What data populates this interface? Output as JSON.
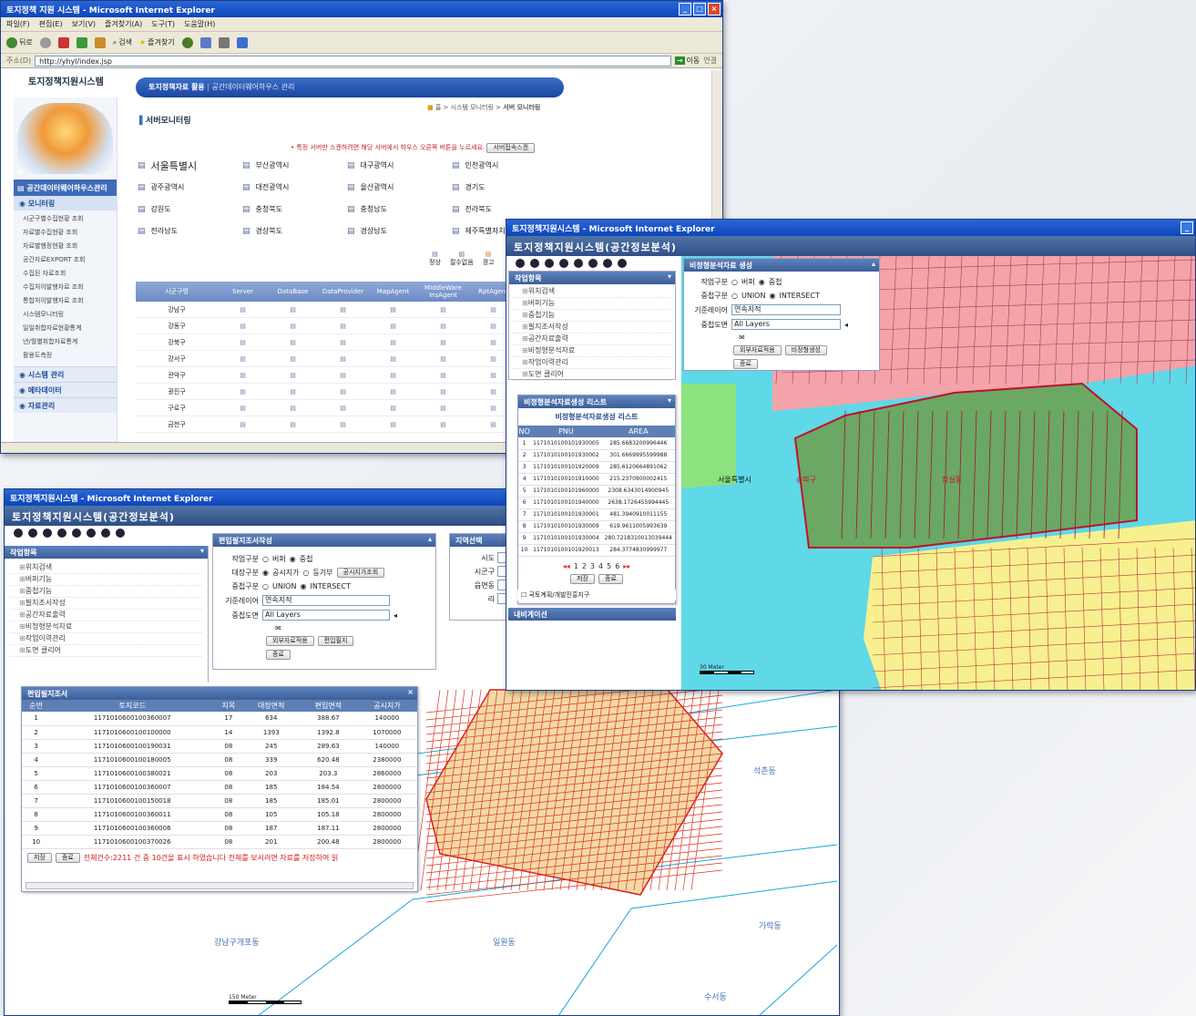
{
  "win1": {
    "title": "토지정책 지원 시스템 - Microsoft Internet Explorer",
    "menu": [
      "파일(F)",
      "편집(E)",
      "보기(V)",
      "즐겨찾기(A)",
      "도구(T)",
      "도움말(H)"
    ],
    "toolbar": {
      "back": "뒤로",
      "search": "검색",
      "favorites": "즐겨찾기"
    },
    "address": {
      "label": "주소(D)",
      "url": "http://yhyl/index.jsp",
      "go": "이동",
      "links": "연결"
    },
    "logo": "토지정책지원시스템",
    "topnav": {
      "item1": "토지정책자료 활용",
      "item2": "공간데이터웨어하우스 관리"
    },
    "breadcrumb": {
      "home": "홈",
      "level1": "시스템 모니터링",
      "current": "서버 모니터링"
    },
    "page_title": "서버모니터링",
    "notice": "• 특정 서버만 스캔하려면 해당 서버에서 하우스 오른쪽 버튼을 누르세요.",
    "notice_button": "서버접속스캔",
    "sidebar_header": "공간데이터웨어하우스관리",
    "sidebar_section": "모니터링",
    "sidebar_items": [
      "시군구별수집현황 조회",
      "자료별수집현황 조회",
      "자료별행정현황 조회",
      "공간자료EXPORT 조회",
      "수집된 자료조회",
      "수집처이발행자료 조회",
      "통합처이발행자료 조회",
      "시스템모니터링",
      "일일취합자료현황통계",
      "년/월별취합자료통계",
      "활용도측정"
    ],
    "sidebar_menus": [
      "시스템 관리",
      "메타데이터",
      "자료관리"
    ],
    "regions": [
      "서울특별시",
      "부산광역시",
      "대구광역시",
      "인천광역시",
      "광주광역시",
      "대전광역시",
      "울산광역시",
      "경기도",
      "강원도",
      "충청북도",
      "충청남도",
      "전라북도",
      "전라남도",
      "경상북도",
      "경상남도",
      "제주특별자치도"
    ],
    "legend": [
      "정상",
      "절수없음",
      "경고"
    ],
    "table_headers": [
      "시군구명",
      "Server",
      "DataBase",
      "DataProvider",
      "MapAgent",
      "MiddleWare InsAgent",
      "RptAgent"
    ],
    "table_rows": [
      "강남구",
      "강동구",
      "강북구",
      "강서구",
      "관악구",
      "광진구",
      "구로구",
      "금천구"
    ]
  },
  "win2": {
    "title": "토지정책지원시스템 - Microsoft Internet Explorer",
    "app_title": "토지정책지원시스템(공간정보분석)",
    "work_panel": "작업항목",
    "work_items": [
      "위치검색",
      "버퍼기능",
      "중첩기능",
      "필지조서작성",
      "공간자료출력",
      "비정형분석자료",
      "작업이력관리",
      "도면 클리어"
    ],
    "form_title": "비정형분석자료 생성",
    "form": {
      "work_type": "작업구분",
      "opt_buffer": "버퍼",
      "opt_overlay": "중첩",
      "overlay_type": "중첩구분",
      "opt_union": "UNION",
      "opt_intersect": "INTERSECT",
      "base_layer": "기준레이어",
      "base_value": "연속지적",
      "overlay_map": "중첩도면",
      "overlay_value": "All Layers",
      "btn_select": "외부자료적용",
      "btn_run": "비정형생성",
      "btn_close": "종료"
    },
    "result_tab": "비정형분석자료생성 리스트",
    "list_title": "비정형분석자료생성 리스트",
    "list_headers": [
      "NO",
      "PNU",
      "AREA"
    ],
    "list_rows": [
      [
        "1",
        "1171010100101930005",
        "285.6683200996446"
      ],
      [
        "2",
        "1171010100101930002",
        "301.6669995599988"
      ],
      [
        "3",
        "1171010100101920009",
        "285.6120664891062"
      ],
      [
        "4",
        "1171010100101910000",
        "215.2370900002415"
      ],
      [
        "5",
        "1171010100101960000",
        "2308.6343014900945"
      ],
      [
        "6",
        "1171010100101940000",
        "2638.1726455994445"
      ],
      [
        "7",
        "1171010100101930001",
        "481.3940910011155"
      ],
      [
        "8",
        "1171010100101930009",
        "619.9611005993639"
      ],
      [
        "9",
        "1171010100101930004",
        "280.7218310013039444"
      ],
      [
        "10",
        "1171010100101920013",
        "284.3774830999977"
      ]
    ],
    "pages": [
      "1",
      "2",
      "3",
      "4",
      "5",
      "6"
    ],
    "btn_save": "저장",
    "btn_close": "종료",
    "checkbox_label": "국토계획/개발진흥지구",
    "nav_panel": "내비게이션",
    "map_labels": {
      "seoul": "서울특별시",
      "gu": "송파구",
      "dong": "잠실동"
    },
    "scale": "30 Meter",
    "colors": {
      "pink": "#f3a3a9",
      "cyan": "#5fd8e8",
      "yellow": "#f7f08e",
      "green": "#6aa864",
      "lightgreen": "#8ce27e"
    }
  },
  "win3": {
    "title": "토지정책지원시스템 - Microsoft Internet Explorer",
    "app_title": "토지정책지원시스템(공간정보분석)",
    "work_panel": "작업항목",
    "work_items": [
      "위치검색",
      "버퍼기능",
      "중첩기능",
      "필지조서작성",
      "공간자료출력",
      "비정형분석자료",
      "작업이력관리",
      "도면 클리어"
    ],
    "form_title": "편입필지조서작성",
    "form": {
      "work_type": "작업구분",
      "opt_buffer": "버퍼",
      "opt_overlay": "중첩",
      "ledger_type": "대장구분",
      "opt_land_price": "공시지가",
      "opt_registry": "등기부",
      "btn_land": "공시지가조회",
      "overlay_type": "중첩구분",
      "opt_union": "UNION",
      "opt_intersect": "INTERSECT",
      "base_layer": "기준레이어",
      "base_value": "연속지적",
      "overlay_map": "중첩도면",
      "overlay_value": "All Layers",
      "btn_select": "외부자료적용",
      "btn_run": "편입필지",
      "btn_close": "종료"
    },
    "region_panel": "지역선택",
    "region_fields": [
      "시도",
      "시군구",
      "읍면동",
      "리"
    ],
    "result_title": "편입필지조서",
    "table_headers": [
      "순번",
      "토지코드",
      "지목",
      "대장면적",
      "편입면적",
      "공시지가"
    ],
    "table_rows": [
      [
        "1",
        "1171010600100360007",
        "17",
        "634",
        "388.67",
        "140000"
      ],
      [
        "2",
        "1171010600100100000",
        "14",
        "1393",
        "1392.8",
        "1070000"
      ],
      [
        "3",
        "1171010600100190031",
        "08",
        "245",
        "289.63",
        "140000"
      ],
      [
        "4",
        "1171010600100180005",
        "08",
        "339",
        "620.48",
        "2380000"
      ],
      [
        "5",
        "1171010600100380021",
        "08",
        "203",
        "203.3",
        "2860000"
      ],
      [
        "6",
        "1171010600100360007",
        "08",
        "185",
        "184.54",
        "2800000"
      ],
      [
        "7",
        "1171010600100150018",
        "08",
        "185",
        "185.01",
        "2800000"
      ],
      [
        "8",
        "1171010600100360011",
        "08",
        "105",
        "105.18",
        "2800000"
      ],
      [
        "9",
        "1171010600100360006",
        "08",
        "187",
        "187.11",
        "2800000"
      ],
      [
        "10",
        "1171010600100370026",
        "08",
        "201",
        "200.48",
        "2800000"
      ]
    ],
    "btn_save": "저장",
    "btn_close": "종료",
    "total_text": "전체건수:2211 건 중 10건을 표시 하였습니다 전체를 보시려면 자료를 저장하여 읽",
    "map_labels": {
      "seokchon": "석촌동",
      "gaepo": "강남구개포동",
      "ilwon": "일원동",
      "garak": "가락동",
      "suseo": "수서동"
    },
    "scale": "150 Meter"
  }
}
